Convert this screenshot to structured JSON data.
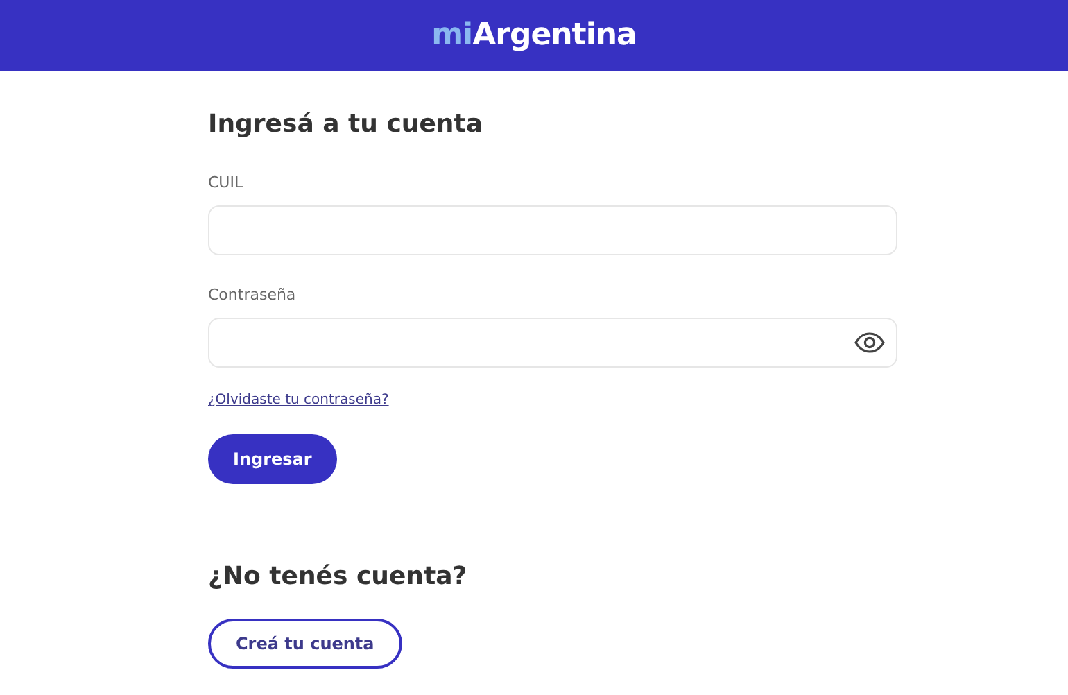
{
  "header": {
    "logo_prefix": "mi",
    "logo_name": "Argentina"
  },
  "login": {
    "title": "Ingresá a tu cuenta",
    "fields": [
      {
        "label": "CUIL",
        "kind": "text"
      },
      {
        "label": "Contraseña",
        "kind": "password"
      }
    ],
    "forgot_link": "¿Olvidaste tu contraseña?",
    "submit_button": "Ingresar"
  },
  "signup": {
    "title": "¿No tenés cuenta?",
    "button": "Creá tu cuenta"
  }
}
